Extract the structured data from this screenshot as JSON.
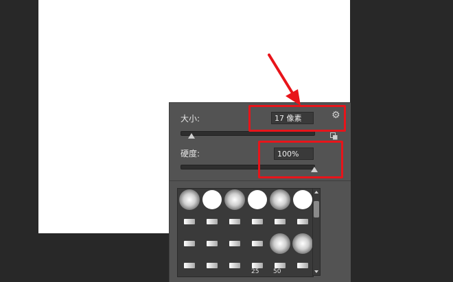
{
  "brush_panel": {
    "size_label": "大小:",
    "size_value": "17 像素",
    "hardness_label": "硬度:",
    "hardness_value": "100%",
    "size_slider_fraction": 0.05,
    "hardness_slider_fraction": 1.0,
    "settings_icon": "gear-icon",
    "reset_icon": "resize-icon"
  },
  "brush_presets": {
    "size_labels": [
      "25",
      "50"
    ]
  },
  "annotation": {
    "color": "#e8141a"
  }
}
